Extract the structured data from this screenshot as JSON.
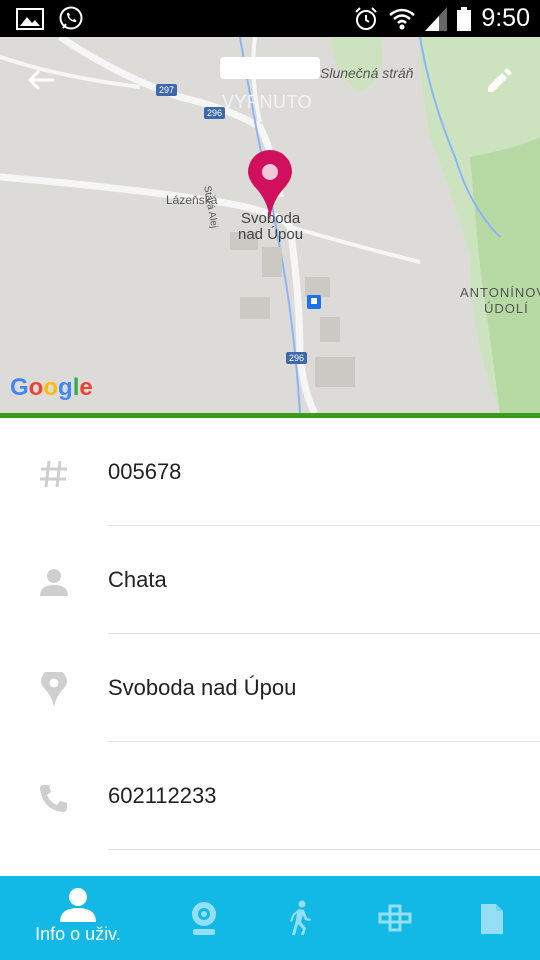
{
  "status_bar": {
    "time": "9:50"
  },
  "map": {
    "subtitle": "VYPNUTO",
    "labels": {
      "slunecna": "Slunečná stráň",
      "lazenska": "Lázeňská",
      "stara": "Stará Alej",
      "town_line1": "Svoboda",
      "town_line2": "nad Úpou",
      "antoninovo_1": "ANTONÍNOVO",
      "antoninovo_2": "ÚDOLÍ"
    },
    "roads": {
      "r297": "297",
      "r296a": "296",
      "r296b": "296"
    },
    "google": "Google"
  },
  "details": [
    {
      "icon": "hash-icon",
      "value": "005678"
    },
    {
      "icon": "person-icon",
      "value": "Chata"
    },
    {
      "icon": "location-pin-icon",
      "value": "Svoboda nad Úpou"
    },
    {
      "icon": "phone-icon",
      "value": "602112233"
    }
  ],
  "bottom_nav": {
    "active_label": "Info o uživ."
  },
  "colors": {
    "accent": "#12b9e6",
    "pin": "#d0105d",
    "divider_green": "#3a9b1d"
  }
}
